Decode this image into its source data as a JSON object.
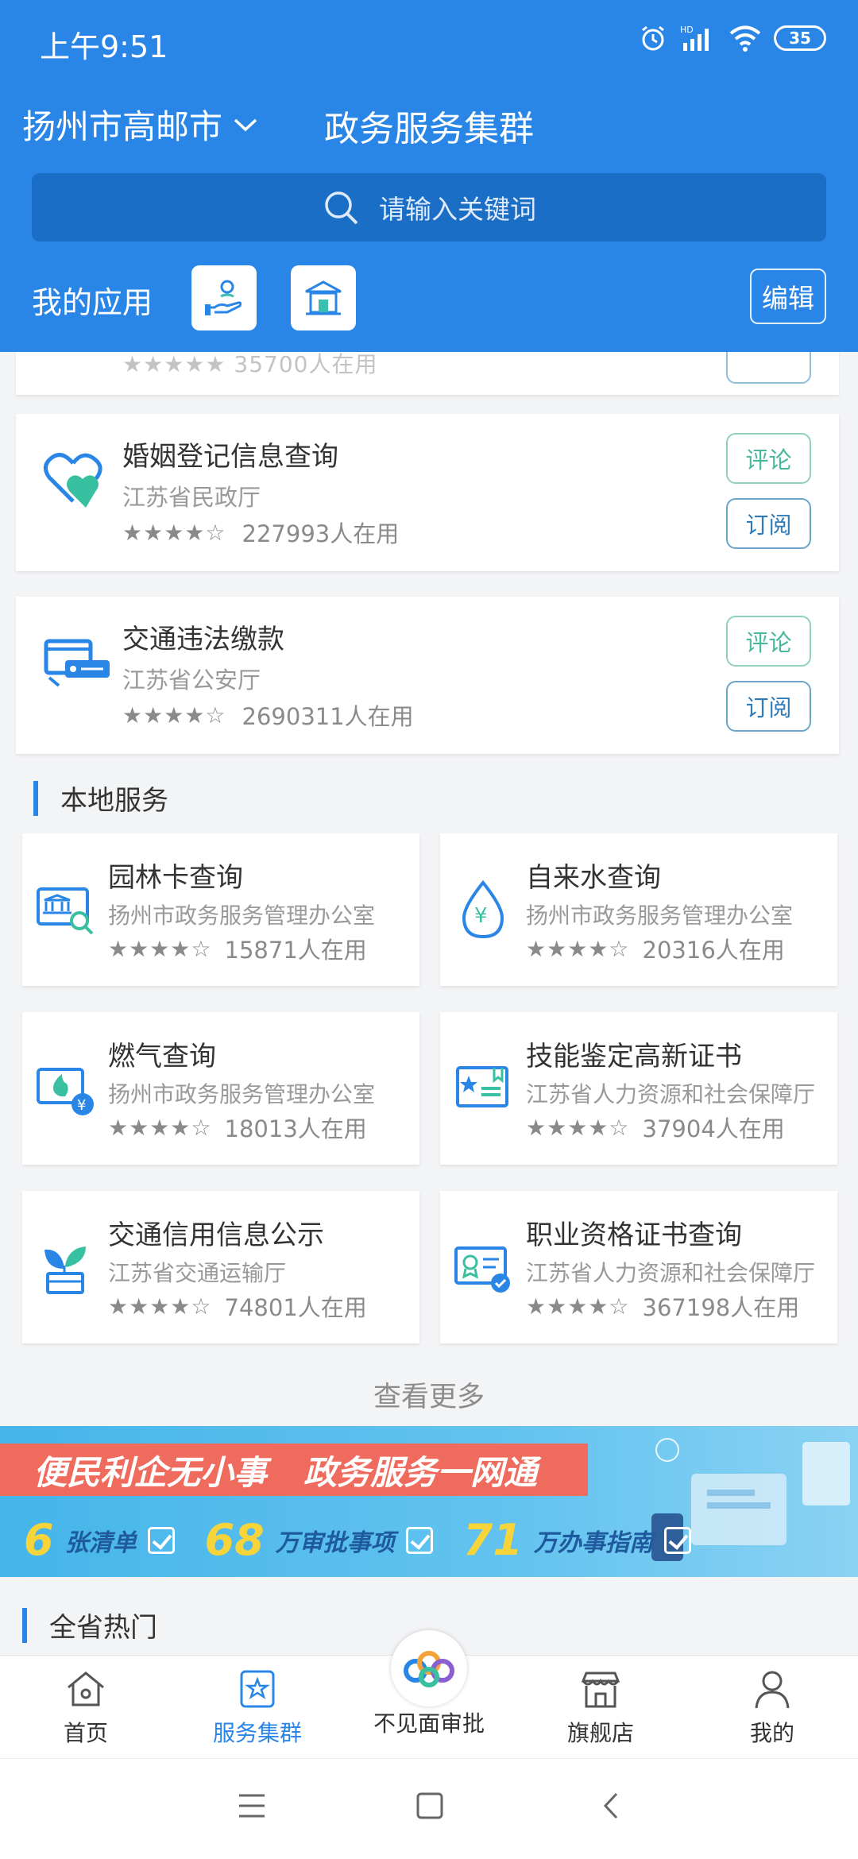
{
  "status_bar": {
    "time": "上午9:51",
    "battery": "35",
    "network": "HD"
  },
  "header": {
    "city": "扬州市高邮市",
    "title": "政务服务集群",
    "search_placeholder": "请输入关键词",
    "my_apps_label": "我的应用",
    "edit_label": "编辑"
  },
  "partial_card": {
    "users": "35700人在用"
  },
  "services": [
    {
      "name": "婚姻登记信息查询",
      "dept": "江苏省民政厅",
      "stars": "★★★★☆",
      "users": "227993人在用",
      "comment": "评论",
      "subscribe": "订阅",
      "icon": "heart-icon"
    },
    {
      "name": "交通违法缴款",
      "dept": "江苏省公安厅",
      "stars": "★★★★☆",
      "users": "2690311人在用",
      "comment": "评论",
      "subscribe": "订阅",
      "icon": "traffic-fine-icon"
    }
  ],
  "local_section": {
    "title": "本地服务"
  },
  "local_services": [
    {
      "name": "园林卡查询",
      "dept": "扬州市政务服务管理办公室",
      "stars": "★★★★☆",
      "users": "15871人在用",
      "icon": "garden-card-icon"
    },
    {
      "name": "自来水查询",
      "dept": "扬州市政务服务管理办公室",
      "stars": "★★★★☆",
      "users": "20316人在用",
      "icon": "water-drop-icon"
    },
    {
      "name": "燃气查询",
      "dept": "扬州市政务服务管理办公室",
      "stars": "★★★★☆",
      "users": "18013人在用",
      "icon": "gas-flame-icon"
    },
    {
      "name": "技能鉴定高新证书",
      "dept": "江苏省人力资源和社会保障厅",
      "stars": "★★★★☆",
      "users": "37904人在用",
      "icon": "certificate-icon"
    },
    {
      "name": "交通信用信息公示",
      "dept": "江苏省交通运输厅",
      "stars": "★★★★☆",
      "users": "74801人在用",
      "icon": "plant-pot-icon"
    },
    {
      "name": "职业资格证书查询",
      "dept": "江苏省人力资源和社会保障厅",
      "stars": "★★★★☆",
      "users": "367198人在用",
      "icon": "qualification-icon"
    }
  ],
  "see_more": "查看更多",
  "banner": {
    "slogan_left": "便民利企无小事",
    "slogan_right": "政务服务一网通",
    "stat1_num": "6",
    "stat1_label": "张清单",
    "stat2_num": "68",
    "stat2_label": "万审批事项",
    "stat3_num": "71",
    "stat3_label": "万办事指南"
  },
  "province_section": {
    "title": "全省热门"
  },
  "bottom_nav": [
    {
      "label": "首页",
      "icon": "home-icon"
    },
    {
      "label": "服务集群",
      "icon": "star-badge-icon",
      "active": true
    },
    {
      "label": "不见面审批",
      "icon": "approval-logo-icon"
    },
    {
      "label": "旗舰店",
      "icon": "store-icon"
    },
    {
      "label": "我的",
      "icon": "user-icon"
    }
  ],
  "colors": {
    "primary": "#2a86e6",
    "search_bg": "#1a6ec6",
    "banner_red": "#ef6b5d",
    "banner_yellow": "#f7d43a",
    "comment_green": "#49b89c",
    "subscribe_blue": "#2f7bb8"
  }
}
